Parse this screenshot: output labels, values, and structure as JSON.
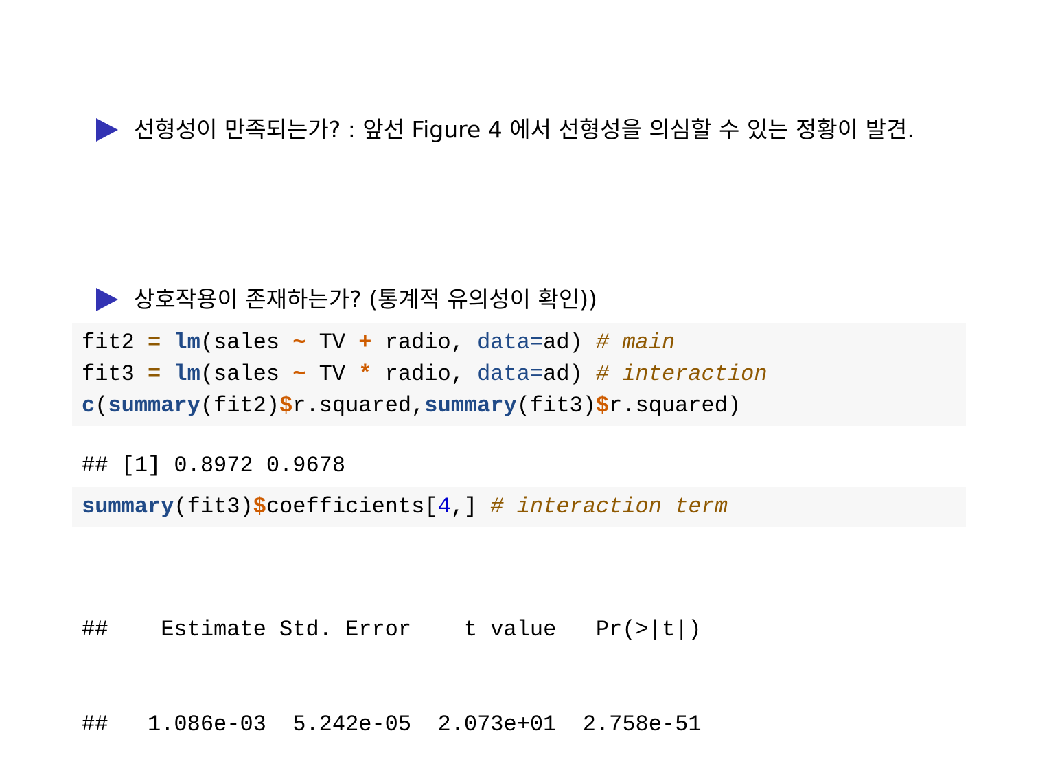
{
  "bullets": [
    {
      "text": "선형성이 만족되는가? : 앞선 Figure 4 에서 선형성을 의심할 수 있는 정황이 발견."
    },
    {
      "text": "상호작용이 존재하는가? (통계적 유의성이 확인))"
    }
  ],
  "code_block_1": [
    [
      [
        "fit2 ",
        "plain"
      ],
      [
        "=",
        "assign"
      ],
      [
        " ",
        "plain"
      ],
      [
        "lm",
        "fn"
      ],
      [
        "(sales ",
        "plain"
      ],
      [
        "~",
        "op"
      ],
      [
        " TV ",
        "plain"
      ],
      [
        "+",
        "op"
      ],
      [
        " radio, ",
        "plain"
      ],
      [
        "data=",
        "arg"
      ],
      [
        "ad) ",
        "plain"
      ],
      [
        "# main",
        "com"
      ]
    ],
    [
      [
        "fit3 ",
        "plain"
      ],
      [
        "=",
        "assign"
      ],
      [
        " ",
        "plain"
      ],
      [
        "lm",
        "fn"
      ],
      [
        "(sales ",
        "plain"
      ],
      [
        "~",
        "op"
      ],
      [
        " TV ",
        "plain"
      ],
      [
        "*",
        "op"
      ],
      [
        " radio, ",
        "plain"
      ],
      [
        "data=",
        "arg"
      ],
      [
        "ad) ",
        "plain"
      ],
      [
        "# interaction",
        "com"
      ]
    ],
    [
      [
        "c",
        "fn"
      ],
      [
        "(",
        "plain"
      ],
      [
        "summary",
        "fn"
      ],
      [
        "(fit2)",
        "plain"
      ],
      [
        "$",
        "op"
      ],
      [
        "r.squared,",
        "plain"
      ],
      [
        "summary",
        "fn"
      ],
      [
        "(fit3)",
        "plain"
      ],
      [
        "$",
        "op"
      ],
      [
        "r.squared)",
        "plain"
      ]
    ]
  ],
  "output_1": "## [1] 0.8972 0.9678",
  "code_block_2": [
    [
      [
        "summary",
        "fn"
      ],
      [
        "(fit3)",
        "plain"
      ],
      [
        "$",
        "op"
      ],
      [
        "coefficients[",
        "plain"
      ],
      [
        "4",
        "num"
      ],
      [
        ",] ",
        "plain"
      ],
      [
        "# interaction term",
        "com"
      ]
    ]
  ],
  "output_2": [
    "##    Estimate Std. Error    t value   Pr(>|t|)",
    "##   1.086e-03  5.242e-05  2.073e+01  2.758e-51"
  ]
}
